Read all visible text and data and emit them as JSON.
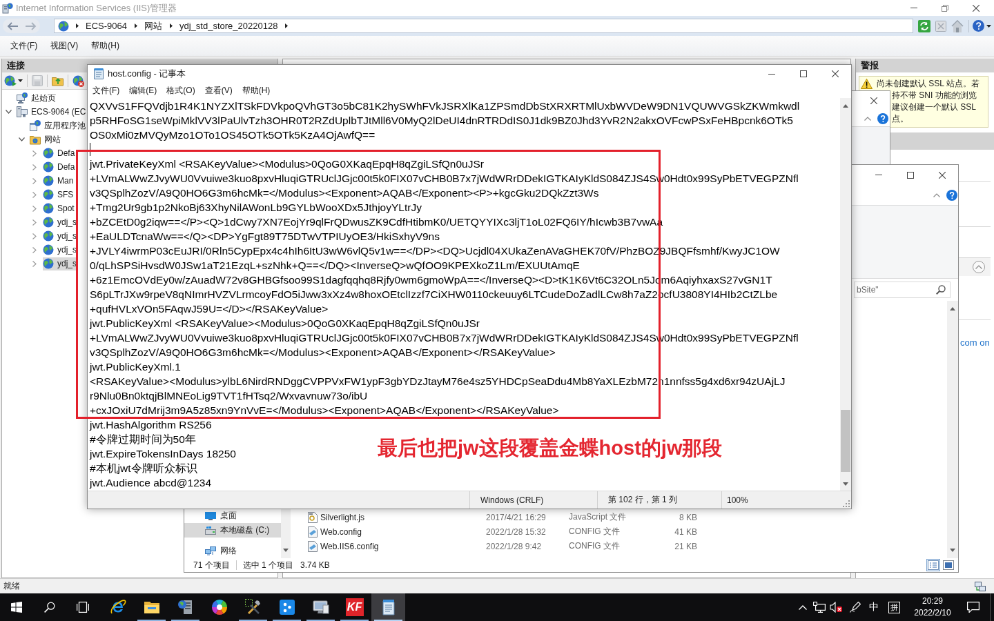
{
  "iis": {
    "title": "Internet Information Services (IIS)管理器",
    "breadcrumb": [
      "ECS-9064",
      "网站",
      "ydj_std_store_20220128"
    ],
    "menu": [
      "文件(F)",
      "视图(V)",
      "帮助(H)"
    ],
    "connections": {
      "title": "连接",
      "tree": [
        {
          "label": "起始页",
          "kind": "start_page",
          "selected": false
        },
        {
          "label": "ECS-9064 (EC",
          "kind": "server",
          "selected": false,
          "expanded": true,
          "children": [
            {
              "label": "应用程序池",
              "kind": "app_pools",
              "selected": false
            },
            {
              "label": "网站",
              "kind": "sites",
              "selected": false,
              "expanded": true,
              "children": [
                {
                  "label": "Defa",
                  "kind": "site",
                  "selected": false,
                  "expanded": false
                },
                {
                  "label": "Defa",
                  "kind": "site",
                  "selected": false,
                  "expanded": false
                },
                {
                  "label": "Man",
                  "kind": "site",
                  "selected": false,
                  "expanded": false
                },
                {
                  "label": "SFS",
                  "kind": "site",
                  "selected": false,
                  "expanded": false
                },
                {
                  "label": "Spot",
                  "kind": "site",
                  "selected": false,
                  "expanded": false
                },
                {
                  "label": "ydj_s",
                  "kind": "site",
                  "selected": false,
                  "expanded": false
                },
                {
                  "label": "ydj_s",
                  "kind": "site",
                  "selected": false,
                  "expanded": false
                },
                {
                  "label": "ydj_s",
                  "kind": "site",
                  "selected": false,
                  "expanded": false
                },
                {
                  "label": "ydj_s",
                  "kind": "site",
                  "selected": true,
                  "expanded": false
                }
              ]
            }
          ]
        }
      ]
    },
    "alerts": {
      "title": "警报",
      "lines": [
        "尚未创建默认 SSL 站点。若",
        "持不带 SNI 功能的浏览",
        "建议创建一个默认 SSL",
        "点。"
      ]
    },
    "actions_link": "com on",
    "status": "就绪"
  },
  "explorer": {
    "search": {
      "placeholder": "bSite\""
    },
    "nav": [
      {
        "label": "桌面",
        "kind": "desktop",
        "selected": false
      },
      {
        "label": "本地磁盘 (C:)",
        "kind": "drive",
        "selected": true
      },
      {
        "label": "网络",
        "kind": "network",
        "selected": false
      }
    ],
    "files": [
      {
        "kind": "script",
        "name": "Silverlight.js",
        "date": "2017/4/21 16:29",
        "type": "JavaScript 文件",
        "size": "8 KB"
      },
      {
        "kind": "config",
        "name": "Web.config",
        "date": "2022/1/28 15:32",
        "type": "CONFIG 文件",
        "size": "41 KB"
      },
      {
        "kind": "config",
        "name": "Web.IIS6.config",
        "date": "2022/1/28 9:42",
        "type": "CONFIG 文件",
        "size": "21 KB"
      }
    ],
    "status": {
      "items": "71 个项目",
      "selection": "选中 1 个项目",
      "size": "3.74 KB"
    },
    "view_modes": [
      {
        "kind": "details",
        "selected": true
      },
      {
        "kind": "large_icons",
        "selected": false
      }
    ]
  },
  "notepad": {
    "title": "host.config - 记事本",
    "menu": [
      "文件(F)",
      "编辑(E)",
      "格式(O)",
      "查看(V)",
      "帮助(H)"
    ],
    "blocks": [
      {
        "kind": "text",
        "lines": [
          "QXVvS1FFQVdjb1R4K1NYZXlTSkFDVkpoQVhGT3o5bC81K2hySWhFVkJSRXlKa1ZPSmdDbStXRXRTMlUxbWVDeW9DN1VQUWVGSkZKWmkwdl",
          "p5RHFoSG1seWpiMklVV3lPaUlvTzh3OHR0T2RZdUplbTJtMll6V0MyQ2lDeUI4dnRTRDdIS0J1dk9BZ0Jhd3YvR2N2akxOVFcwPSxFeHBpcnk6OTk5",
          "OS0xMi0zMVQyMzo1OTo1OS45OTk5OTk5KzA4OjAwfQ=="
        ]
      },
      {
        "kind": "caret_line"
      },
      {
        "kind": "text",
        "lines": [
          "jwt.PrivateKeyXml <RSAKeyValue><Modulus>0QoG0XKaqEpqH8qZgiLSfQn0uJSr",
          "+LVmALWwZJvyWU0Vvuiwe3kuo8pxvHluqiGTRUclJGjc00t5k0FIX07vCHB0B7x7jWdWRrDDekIGTKAIyKldS084ZJS4Sw0Hdt0x99SyPbETVEGPZNfl",
          "v3QSplhZozV/A9Q0HO6G3m6hcMk=</Modulus><Exponent>AQAB</Exponent><P>+kgcGku2DQkZzt3Ws",
          "+Tmg2Ur9gb1p2NkoBj63XhyNilAWonLb9GYLbWooXDx5JthjoyYLtrJy",
          "+bZCEtD0g2iqw==</P><Q>1dCwy7XN7EojYr9qlFrQDwusZK9CdfHtibmK0/UETQYYIXc3ljT1oL02FQ6IY/hIcwb3B7vwAa",
          "+EaULDTcnaWw==</Q><DP>YgFgt89T75DTwVTPIUyOE3/HkiSxhyV9ns",
          "+JVLY4iwrmP03cEuJRI/0Rln5CypEpx4c4hIh6ItU3wW6vlQ5v1w==</DP><DQ>Ucjdl04XUkaZenAVaGHEK70fV/PhzBOZ9JBQFfsmhf/KwyJC1OW",
          "0/qLhSPSiHvsdW0JSw1aT21EzqL+szNhk+Q==</DQ><InverseQ>wQfOO9KPEXkoZ1Lm/EXUUtAmqE",
          "+6z1EmcOVdEy0w/zAuadW72v8GHBGfsoo99S1dagfqqhq8Rjfy0wm6gmoWpA==</InverseQ><D>tK1K6Vt6C32OLn5Jom6AqiyhxaxS27vGN1T",
          "S6pLTrJXw9rpeV8qNImrHVZVLrmcoyFdO5iJww3xXz4w8hoxOEtclIzzf7CiXHW0110ckeuuy6LTCudeDoZadlLCw8h7aZ2ocfU3808YI4HIb2CtZLbe",
          "+qufHVLxVOn5FAqwJ59U=</D></RSAKeyValue>",
          "jwt.PublicKeyXml <RSAKeyValue><Modulus>0QoG0XKaqEpqH8qZgiLSfQn0uJSr",
          "+LVmALWwZJvyWU0Vvuiwe3kuo8pxvHluqiGTRUclJGjc00t5k0FIX07vCHB0B7x7jWdWRrDDekIGTKAIyKldS084ZJS4Sw0Hdt0x99SyPbETVEGPZNfl",
          "v3QSplhZozV/A9Q0HO6G3m6hcMk=</Modulus><Exponent>AQAB</Exponent></RSAKeyValue>",
          "jwt.PublicKeyXml.1",
          "<RSAKeyValue><Modulus>ylbL6NirdRNDggCVPPVxFW1ypF3gbYDzJtayM76e4sz5YHDCpSeaDdu4Mb8YaXLEzbM72n1nnfss5g4xd6xr94zUAjLJ",
          "r9Nlu0Bn0ktqjBlMNEoLig9TVT1fHTsq2/Wxvavnuw73o/ibU",
          "+cxJOxiU7dMrij3m9A5z85xn9YnVvE=</Modulus><Exponent>AQAB</Exponent></RSAKeyValue>",
          "jwt.HashAlgorithm RS256",
          "#令牌过期时间为50年",
          "jwt.ExpireTokensInDays 18250",
          "#本机jwt令牌听众标识",
          "jwt.Audience abcd@1234"
        ]
      }
    ],
    "status": {
      "line_ending": "Windows (CRLF)",
      "position": "第 102 行，第 1 列",
      "zoom": "100%"
    }
  },
  "annotation": {
    "text": "最后也把jw这段覆盖金蝶host的jw那段",
    "frame": true
  },
  "taskbar": {
    "apps": [
      {
        "kind": "ie",
        "running": false,
        "selected": false
      },
      {
        "kind": "explorer",
        "running": true,
        "selected": false
      },
      {
        "kind": "server_manager",
        "running": true,
        "selected": false
      },
      {
        "kind": "color_wheel",
        "running": false,
        "selected": false
      },
      {
        "kind": "tools",
        "running": true,
        "selected": false
      },
      {
        "kind": "dots_app",
        "running": true,
        "selected": false
      },
      {
        "kind": "computer",
        "running": true,
        "selected": false
      },
      {
        "kind": "kf",
        "label": "KF",
        "running": true,
        "selected": false
      },
      {
        "kind": "notepad",
        "running": true,
        "selected": true
      }
    ],
    "tray": {
      "ime_mode": "中",
      "ime": "拼",
      "time": "20:29",
      "date": "2022/2/10"
    }
  }
}
